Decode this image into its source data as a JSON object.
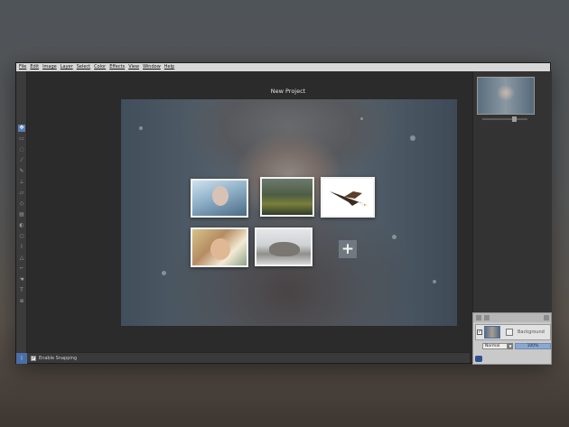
{
  "menu": [
    "File",
    "Edit",
    "Image",
    "Layer",
    "Select",
    "Color",
    "Effects",
    "View",
    "Window",
    "Help"
  ],
  "document": {
    "title": "New Project"
  },
  "status": {
    "snapping_label": "Enable Snapping",
    "snapping_checked": true
  },
  "layers": {
    "name": "Background",
    "blend_mode": "Normal",
    "opacity": "100%"
  },
  "icons": {
    "move": "move-icon",
    "add": "plus-icon"
  }
}
